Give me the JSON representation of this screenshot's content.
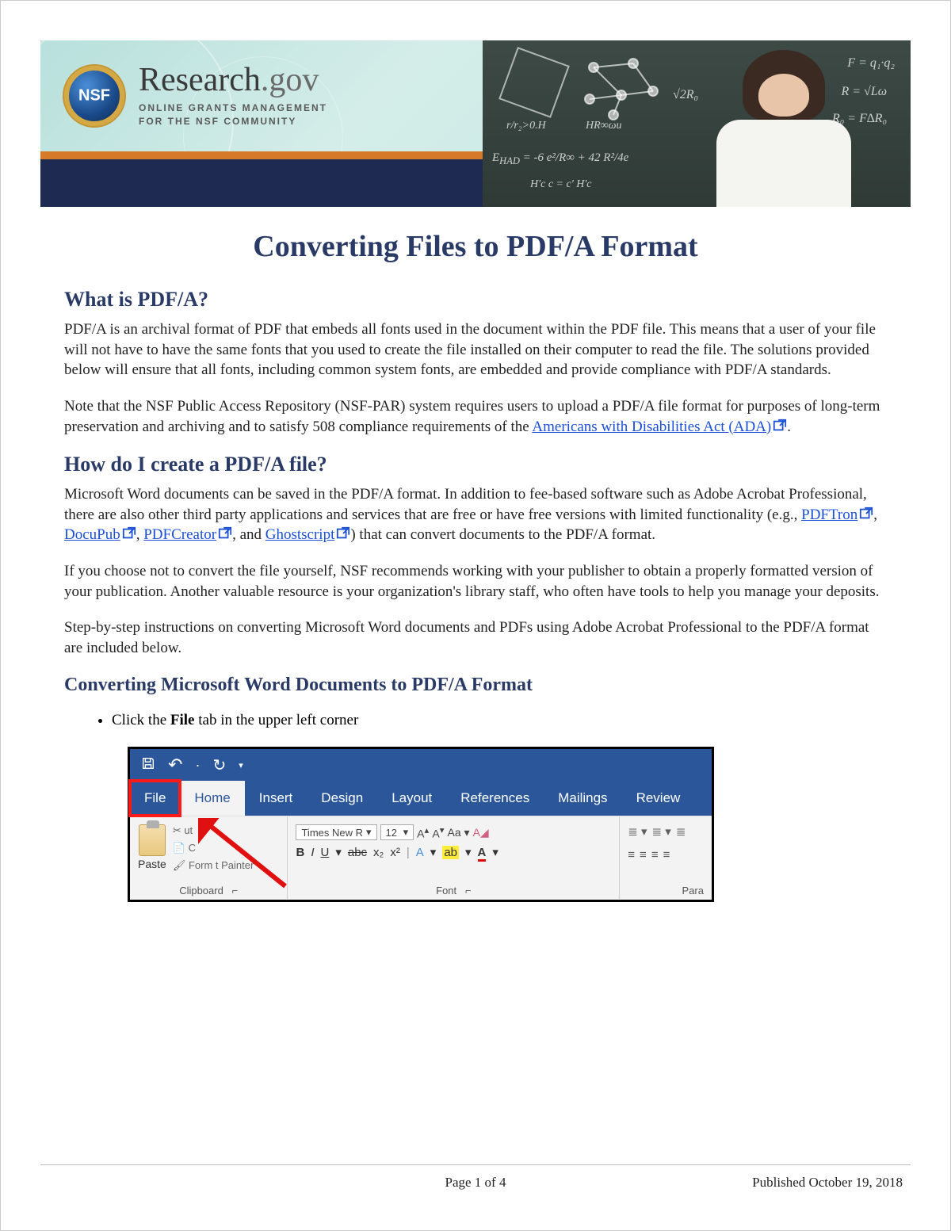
{
  "banner": {
    "brand_main": "Research",
    "brand_suffix": ".gov",
    "brand_line1": "ONLINE GRANTS MANAGEMENT",
    "brand_line2": "FOR THE NSF COMMUNITY"
  },
  "title": "Converting Files to PDF/A Format",
  "section1": {
    "heading": "What is PDF/A?",
    "p1": "PDF/A is an archival format of PDF that embeds all fonts used in the document within the PDF file. This means that a user of your file will not have to have the same fonts that you used to create the file installed on their computer to read the file. The solutions provided below will ensure that all fonts, including common system fonts, are embedded and provide compliance with PDF/A standards.",
    "p2_pre": "Note that the NSF Public Access Repository (NSF-PAR) system requires users to upload a PDF/A file format for purposes of long-term preservation and archiving and to satisfy 508 compliance requirements of the ",
    "p2_link": "Americans with Disabilities Act (ADA)",
    "p2_post": "."
  },
  "section2": {
    "heading": "How do I create a PDF/A file?",
    "p1_pre": "Microsoft Word documents can be saved in the PDF/A format. In addition to fee-based software such as Adobe Acrobat Professional, there are also other third party applications and services that are free or have free versions with limited functionality (e.g., ",
    "link1": "PDFTron",
    "sep1": ", ",
    "link2": "DocuPub",
    "sep2": ", ",
    "link3": "PDFCreator",
    "sep3": ", and ",
    "link4": "Ghostscript",
    "p1_post": ") that can convert documents to the PDF/A format.",
    "p2": "If you choose not to convert the file yourself, NSF recommends working with your publisher to obtain a properly formatted version of your publication. Another valuable resource is your organization's library staff, who often have tools to help you manage your deposits.",
    "p3": "Step-by-step instructions on converting Microsoft Word documents and PDFs using Adobe Acrobat Professional to the PDF/A format are included below."
  },
  "section3": {
    "heading": "Converting Microsoft Word Documents to PDF/A Format",
    "step1_pre": "Click the ",
    "step1_bold": "File",
    "step1_post": " tab in the upper left corner"
  },
  "word": {
    "tabs": {
      "file": "File",
      "home": "Home",
      "insert": "Insert",
      "design": "Design",
      "layout": "Layout",
      "references": "References",
      "mailings": "Mailings",
      "review": "Review"
    },
    "clipboard": {
      "paste": "Paste",
      "cut": "ut",
      "copy": "C",
      "painter": "Form   t Painter",
      "label": "Clipboard"
    },
    "font": {
      "name": "Times New R",
      "size": "12",
      "label": "Font"
    },
    "para_label": "Para"
  },
  "footer": {
    "page": "Page 1 of 4",
    "published": "Published October 19, 2018"
  }
}
